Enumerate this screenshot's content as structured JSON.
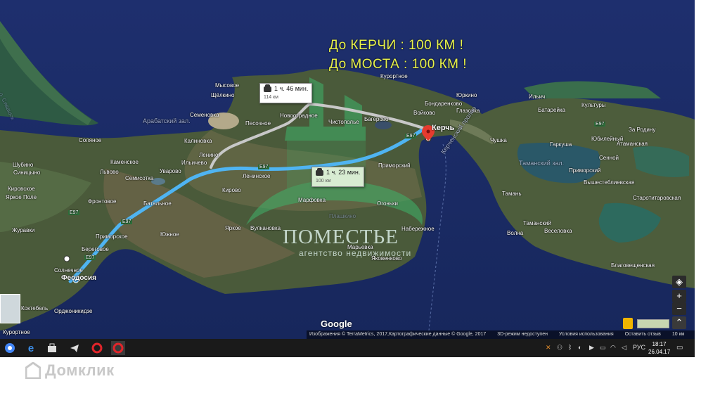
{
  "headline": {
    "line1": "До КЕРЧИ   : 100 КМ !",
    "line2": "До МОСТА : 100 КМ !"
  },
  "routes": {
    "alt": {
      "time": "1 ч. 46 мин.",
      "distance": "114 км"
    },
    "main": {
      "time": "1 ч. 23 мин.",
      "distance": "100 км"
    }
  },
  "watermark": {
    "title": "ПОМЕСТЬЕ",
    "subtitle": "агентство недвижимости"
  },
  "places": {
    "kerch": "Керчь",
    "feodosia": "Феодосия",
    "mysovoe": "Мысовое",
    "schelkino": "Щёлкино",
    "semenovka": "Семеновка",
    "arabat_bay": "Арабатский зал.",
    "novootradnoe": "Новоотрадное",
    "pesochnoe": "Песочное",
    "chistopolie": "Чистополье",
    "bagerovo": "Багерово",
    "voykovo": "Войково",
    "kurortnoe_n": "Курортное",
    "yurkino": "Юркино",
    "bondarenkovo": "Бондаренково",
    "glazovka": "Глазовка",
    "kalinovka": "Калиновка",
    "lenino": "Ленино",
    "ilyichevo": "Ильичево",
    "uvarovo": "Уварово",
    "semisotka": "Семисотка",
    "kamenskoe": "Каменское",
    "lvovo": "Львово",
    "solyanoe": "Соляное",
    "shubino": "Шубино",
    "sinitsyno": "Синицыно",
    "kirovskoe": "Кировское",
    "yarkoe_pole": "Яркое Поле",
    "zhuravki": "Журавки",
    "frontovoe": "Фронтовое",
    "batalnoe": "Батальное",
    "leninskoe": "Ленинское",
    "kirovo": "Кирово",
    "primorskoe": "Приморское",
    "marfovka": "Марфовка",
    "plashkino": "Плашкино",
    "ogonki": "Огоньки",
    "primorsky": "Приморский",
    "yuzhnoe": "Южное",
    "beregovoe": "Береговое",
    "solnechnoe": "Солнечное",
    "yarkoe": "Яркое",
    "vulkanovka": "Вулкановка",
    "naberezhnoe": "Набережное",
    "marfovka2": "Марьевка",
    "yakovenkovo": "Яковенково",
    "koktebel": "Коктебель",
    "ordzhonikidze": "Орджоникидзе",
    "kurortnoe_s": "Курортное",
    "chushka": "Чушка",
    "ilyich": "Ильич",
    "batareyka": "Батарейка",
    "kultury": "Культуры",
    "garkusha": "Гаркуша",
    "taman_bay": "Таманский зал.",
    "taman": "Тамань",
    "tamansky": "Таманский",
    "volna": "Волна",
    "veselovka": "Веселовка",
    "primorsky_e": "Приморский",
    "yubileyny": "Юбилейный",
    "senoy": "Сенной",
    "za_rodinu": "За Родину",
    "atamanskoe": "Атаманская",
    "vyshesteblievskaya": "Вышестеблиевская",
    "starotitarovskaya": "Старотитаровская",
    "blagoveshchenskaya": "Благовещенская",
    "kerch_strait": "Керченский пролив",
    "karkinit_strip": "о. Сивашок"
  },
  "road_labels": [
    "E97",
    "E97",
    "E97",
    "E97",
    "E97",
    "E97"
  ],
  "map_controls": {
    "zoom_in": "+",
    "zoom_out": "−"
  },
  "google_logo": "Google",
  "attribution": {
    "imagery": "Изображения © TerraMetrics, 2017,Картографические данные © Google, 2017",
    "mode": "3D-режим недоступен",
    "terms": "Условия использования",
    "report": "Оставить отзыв",
    "scale": "10 км"
  },
  "taskbar": {
    "language": "РУС",
    "time": "18:17",
    "date": "26.04.17"
  },
  "brand": {
    "text": "Домклик"
  },
  "colors": {
    "route_main": "#4fb4f2",
    "route_alt": "#c8c8c8",
    "headline": "#e8f24a",
    "sea": "#1d2f6b"
  }
}
